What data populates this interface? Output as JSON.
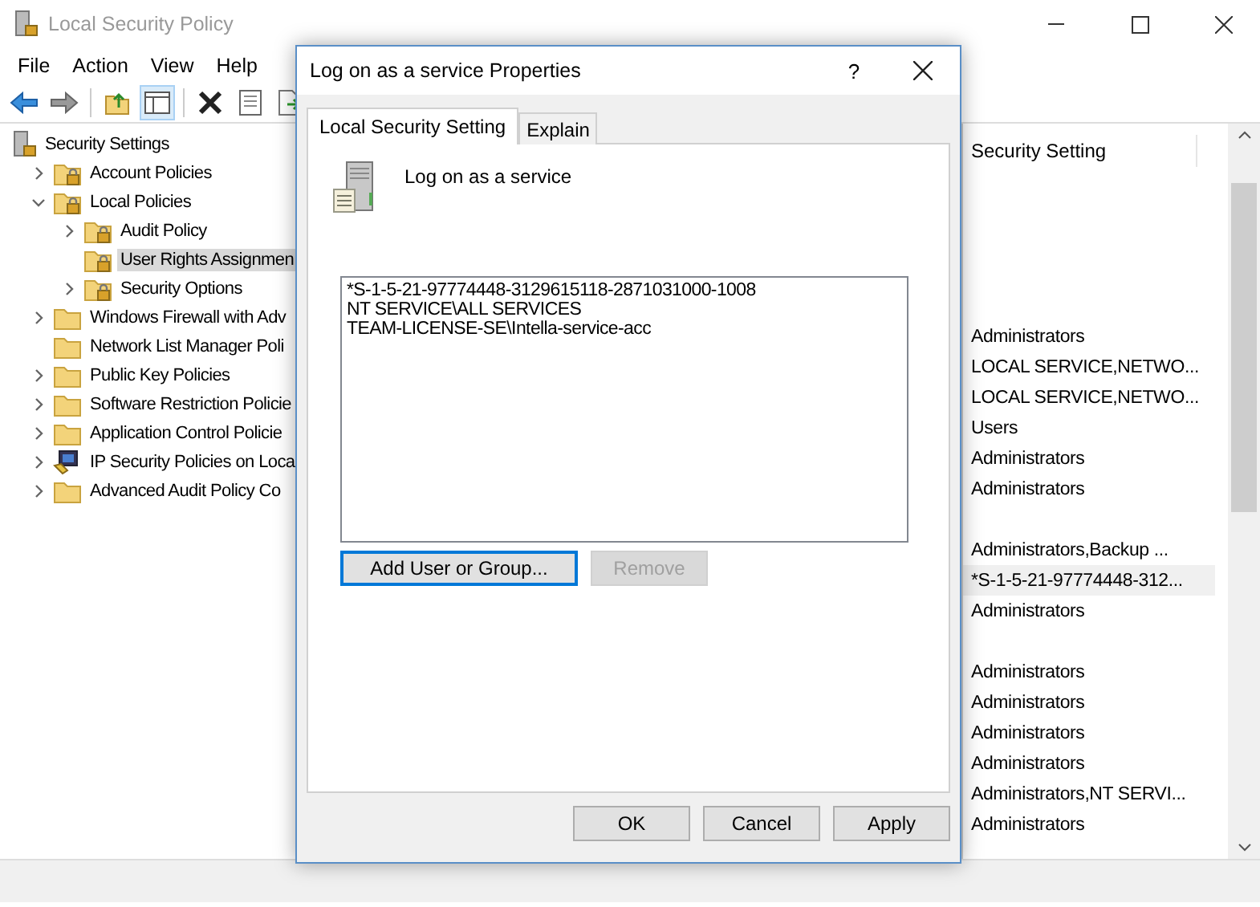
{
  "window": {
    "title": "Local Security Policy"
  },
  "menu": [
    "File",
    "Action",
    "View",
    "Help"
  ],
  "tree": {
    "label": "Security Settings",
    "kind": "policy",
    "children": [
      {
        "label": "Account Policies",
        "kind": "locked-folder",
        "expanded": false,
        "selected": false
      },
      {
        "label": "Local Policies",
        "kind": "locked-folder",
        "expanded": true,
        "selected": false,
        "children": [
          {
            "label": "Audit Policy",
            "kind": "locked-folder",
            "expanded": false,
            "selected": false
          },
          {
            "label": "User Rights Assignmen",
            "kind": "locked-folder",
            "selected": true
          },
          {
            "label": "Security Options",
            "kind": "locked-folder",
            "expanded": false,
            "selected": false
          }
        ]
      },
      {
        "label": "Windows Firewall with Adv",
        "kind": "folder",
        "expanded": false,
        "selected": false
      },
      {
        "label": "Network List Manager Poli",
        "kind": "folder",
        "selected": false
      },
      {
        "label": "Public Key Policies",
        "kind": "folder",
        "expanded": false,
        "selected": false
      },
      {
        "label": "Software Restriction Policie",
        "kind": "folder",
        "expanded": false,
        "selected": false
      },
      {
        "label": "Application Control Policie",
        "kind": "folder",
        "expanded": false,
        "selected": false
      },
      {
        "label": "IP Security Policies on Loca",
        "kind": "ip-policy",
        "expanded": false,
        "selected": false
      },
      {
        "label": "Advanced Audit Policy Co",
        "kind": "folder",
        "expanded": false,
        "selected": false
      }
    ]
  },
  "settings_pane": {
    "column": "Security Setting",
    "rows": [
      {
        "selected": false
      },
      {
        "selected": false
      },
      {
        "selected": false
      },
      {
        "selected": false
      },
      {
        "selected": false
      },
      {
        "setting": "Administrators",
        "selected": false
      },
      {
        "setting": "LOCAL SERVICE,NETWO...",
        "selected": false
      },
      {
        "setting": "LOCAL SERVICE,NETWO...",
        "selected": false
      },
      {
        "setting": "Users",
        "selected": false
      },
      {
        "setting": "Administrators",
        "selected": false
      },
      {
        "setting": "Administrators",
        "selected": false
      },
      {
        "selected": false
      },
      {
        "setting": "Administrators,Backup ...",
        "selected": false
      },
      {
        "setting": "*S-1-5-21-97774448-312...",
        "selected": true
      },
      {
        "setting": "Administrators",
        "selected": false
      },
      {
        "selected": false
      },
      {
        "setting": "Administrators",
        "selected": false
      },
      {
        "setting": "Administrators",
        "selected": false
      },
      {
        "setting": "Administrators",
        "selected": false
      },
      {
        "setting": "Administrators",
        "selected": false
      },
      {
        "setting": "Administrators,NT SERVI...",
        "selected": false
      },
      {
        "setting": "Administrators",
        "selected": false
      }
    ]
  },
  "dialog": {
    "title": "Log on as a service Properties",
    "help": "?",
    "tabs": [
      {
        "label": "Local Security Setting",
        "selected": true
      },
      {
        "label": "Explain",
        "selected": false
      }
    ],
    "policy_name": "Log on as a service",
    "accounts": [
      "*S-1-5-21-97774448-3129615118-2871031000-1008",
      "NT SERVICE\\ALL SERVICES",
      "TEAM-LICENSE-SE\\Intella-service-acc"
    ],
    "list_buttons": [
      {
        "label": "Add User or Group...",
        "disabled": false,
        "focused": true
      },
      {
        "label": "Remove",
        "disabled": true,
        "focused": false
      }
    ],
    "buttons": [
      "OK",
      "Cancel",
      "Apply"
    ]
  }
}
